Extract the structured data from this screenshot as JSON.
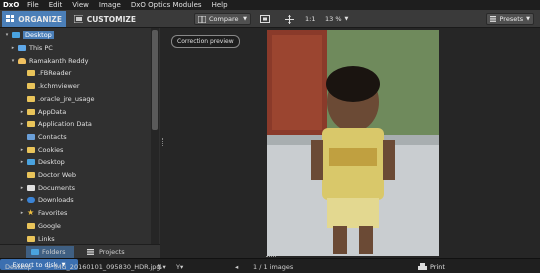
{
  "app": {
    "logo": "DxO"
  },
  "menu": [
    "File",
    "Edit",
    "View",
    "Image",
    "DxO Optics Modules",
    "Help"
  ],
  "toolbar": {
    "organize": "ORGANIZE",
    "customize": "CUSTOMIZE",
    "compare": "Compare",
    "zoom_ratio": "1:1",
    "zoom_percent": "13 %",
    "presets": "Presets"
  },
  "tree": [
    {
      "label": "Desktop",
      "icon": "folder-blue",
      "arrow": "▾",
      "indent": 0,
      "selected": true
    },
    {
      "label": "This PC",
      "icon": "pc-icon",
      "arrow": "▸",
      "indent": 1
    },
    {
      "label": "Ramakanth Reddy",
      "icon": "user-icon",
      "arrow": "▾",
      "indent": 1
    },
    {
      "label": ".FBReader",
      "icon": "folder",
      "arrow": "",
      "indent": 2
    },
    {
      "label": ".kchmviewer",
      "icon": "folder",
      "arrow": "",
      "indent": 2
    },
    {
      "label": ".oracle_jre_usage",
      "icon": "folder",
      "arrow": "",
      "indent": 2
    },
    {
      "label": "AppData",
      "icon": "folder",
      "arrow": "▸",
      "indent": 2
    },
    {
      "label": "Application Data",
      "icon": "folder",
      "arrow": "▸",
      "indent": 2
    },
    {
      "label": "Contacts",
      "icon": "contacts-icon",
      "arrow": "",
      "indent": 2
    },
    {
      "label": "Cookies",
      "icon": "folder",
      "arrow": "▸",
      "indent": 2
    },
    {
      "label": "Desktop",
      "icon": "folder-blue",
      "arrow": "▸",
      "indent": 2
    },
    {
      "label": "Doctor Web",
      "icon": "folder",
      "arrow": "",
      "indent": 2
    },
    {
      "label": "Documents",
      "icon": "doc-icon",
      "arrow": "▸",
      "indent": 2
    },
    {
      "label": "Downloads",
      "icon": "dl-icon",
      "arrow": "▸",
      "indent": 2
    },
    {
      "label": "Favorites",
      "icon": "star-icon",
      "arrow": "▸",
      "indent": 2
    },
    {
      "label": "Google",
      "icon": "folder",
      "arrow": "",
      "indent": 2
    },
    {
      "label": "Links",
      "icon": "folder",
      "arrow": "",
      "indent": 2
    }
  ],
  "panel_tabs": {
    "folders": "Folders",
    "projects": "Projects"
  },
  "viewer": {
    "correction_preview": "Correction preview"
  },
  "statusbar": {
    "breadcrumb_root": "Desktop",
    "filename": "IMG_20160101_095830_HDR.jpg",
    "count": "1 / 1 images",
    "print": "Print",
    "export": "Export to disk"
  },
  "colors": {
    "accent": "#4b7fb8",
    "export": "#3b6fb0"
  }
}
